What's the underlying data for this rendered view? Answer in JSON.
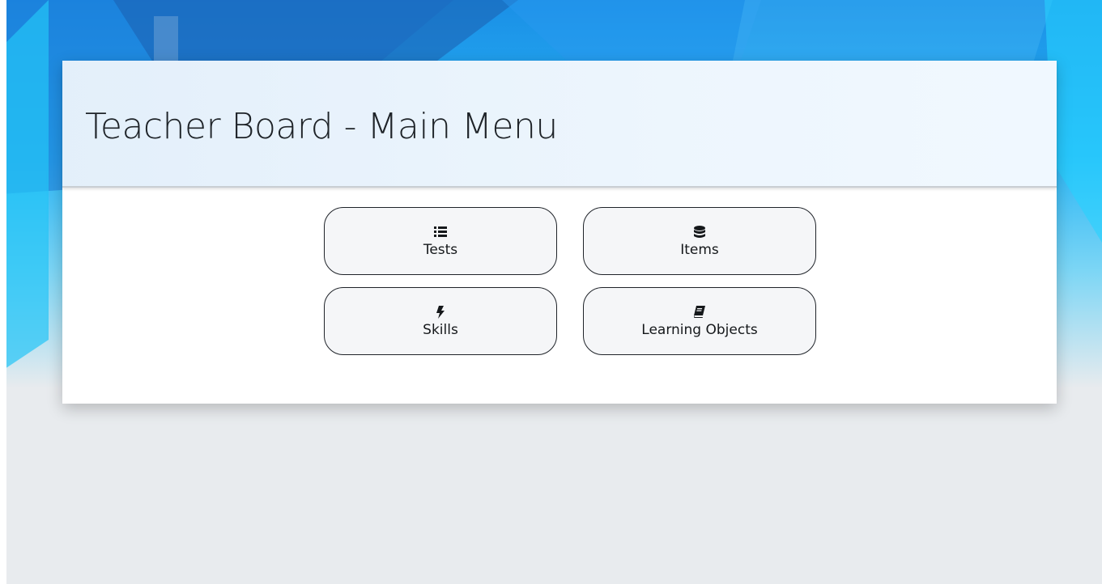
{
  "header": {
    "title": "Teacher Board - Main Menu"
  },
  "menu": {
    "items": [
      {
        "label": "Tests",
        "icon": "list-icon"
      },
      {
        "label": "Items",
        "icon": "database-icon"
      },
      {
        "label": "Skills",
        "icon": "bolt-icon"
      },
      {
        "label": "Learning Objects",
        "icon": "book-icon"
      }
    ]
  },
  "colors": {
    "background": "#e8ebee",
    "hero_blue": "#1a8fe6",
    "hero_cyan": "#29b5f5",
    "button_bg": "#f5f6f8",
    "button_border": "#1f2329"
  }
}
